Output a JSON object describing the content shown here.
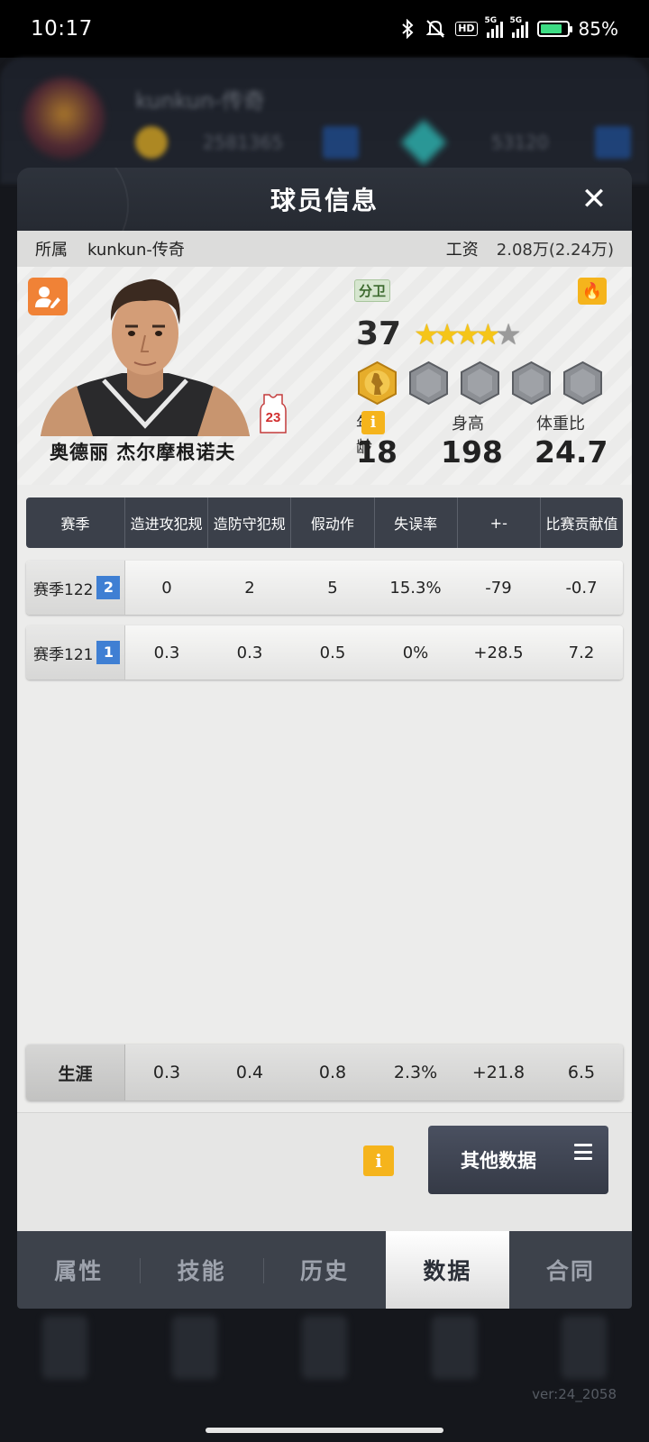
{
  "status_bar": {
    "time": "10:17",
    "hd_label": "HD",
    "network1": "5G",
    "network2": "5G",
    "battery": "85%"
  },
  "background": {
    "team_name": "kunkun-传奇",
    "coins": "2581365",
    "gems": "53120",
    "version": "ver:24_2058"
  },
  "modal": {
    "title": "球员信息",
    "close": "✕",
    "club_label": "所属",
    "club_name": "kunkun-传奇",
    "salary_label": "工资",
    "salary_value": "2.08万(2.24万)",
    "player": {
      "name": "奥德丽 杰尔摩根诺夫",
      "jersey_number": "23",
      "position": "分卫",
      "overall": "37",
      "stars_full": 4,
      "stars_total": 5,
      "age_label": "年龄",
      "age": "18",
      "height_label": "身高",
      "height": "198",
      "weight_ratio_label": "体重比",
      "weight_ratio": "24.7",
      "info_icon": "i"
    },
    "table": {
      "headers": [
        "赛季",
        "造进攻犯规",
        "造防守犯规",
        "假动作",
        "失误率",
        "+-",
        "比赛贡献值"
      ],
      "rows": [
        {
          "season": "赛季122",
          "season_no": "2",
          "values": [
            "0",
            "2",
            "5",
            "15.3%",
            "-79",
            "-0.7"
          ]
        },
        {
          "season": "赛季121",
          "season_no": "1",
          "values": [
            "0.3",
            "0.3",
            "0.5",
            "0%",
            "+28.5",
            "7.2"
          ]
        }
      ],
      "career": {
        "label": "生涯",
        "values": [
          "0.3",
          "0.4",
          "0.8",
          "2.3%",
          "+21.8",
          "6.5"
        ]
      }
    },
    "footer": {
      "info_icon": "i",
      "other_data_label": "其他数据"
    },
    "tabs": [
      "属性",
      "技能",
      "历史",
      "数据",
      "合同"
    ],
    "active_tab": "数据"
  },
  "colors": {
    "header_bg": "#2e333c",
    "accent_orange": "#f08236",
    "info_yellow": "#f5b41c",
    "season_blue": "#3f7fd3",
    "star_gold": "#f5c518"
  }
}
